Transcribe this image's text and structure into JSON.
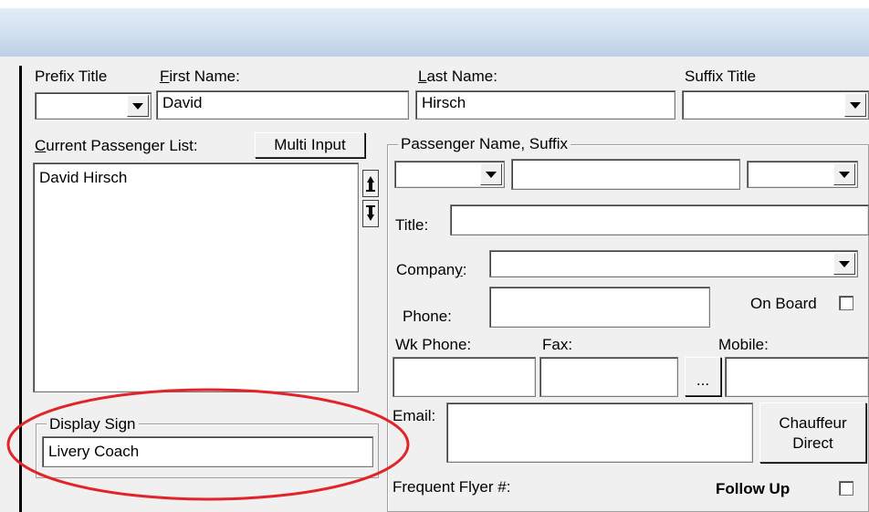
{
  "labels": {
    "prefix_title": "Prefix Title",
    "first_name_pre": "",
    "first_name_key": "F",
    "first_name_rest": "irst Name:",
    "last_name_key": "L",
    "last_name_rest": "ast Name:",
    "suffix_title": "Suffix Title",
    "current_passenger_key": "C",
    "current_passenger_rest": "urrent Passenger List:",
    "passenger_name_suffix": "Passenger Name, Suffix",
    "title": "Title:",
    "company_pre": "Compan",
    "company_key": "y",
    "company_post": ":",
    "phone": "Phone:",
    "on_board": "On Board",
    "wk_phone": "Wk Phone:",
    "fax": "Fax:",
    "mobile": "Mobile:",
    "email": "Email:",
    "frequent_flyer": "Frequent Flyer #:",
    "follow_up": "Follow Up",
    "display_sign": "Display Sign"
  },
  "fields": {
    "prefix_title": "",
    "first_name": "David",
    "last_name": "Hirsch",
    "suffix_title": "",
    "passenger_prefix": "",
    "passenger_name": "",
    "passenger_suffix": "",
    "title": "",
    "company": "",
    "phone": "",
    "wk_phone": "",
    "fax": "",
    "mobile": "",
    "email": "",
    "display_sign": "Livery Coach"
  },
  "buttons": {
    "multi_input": "Multi Input",
    "ellipsis": "...",
    "chauffeur_direct_line1": "Chauffeur",
    "chauffeur_direct_line2": "Direct"
  },
  "passenger_list": [
    "David Hirsch"
  ],
  "checkboxes": {
    "on_board": false,
    "follow_up": false
  },
  "colors": {
    "annotation_ellipse": "#e0242a",
    "window_bg": "#f0f0f0"
  },
  "icons": {
    "move_up": "arrow-up-icon",
    "move_down": "arrow-down-icon"
  }
}
